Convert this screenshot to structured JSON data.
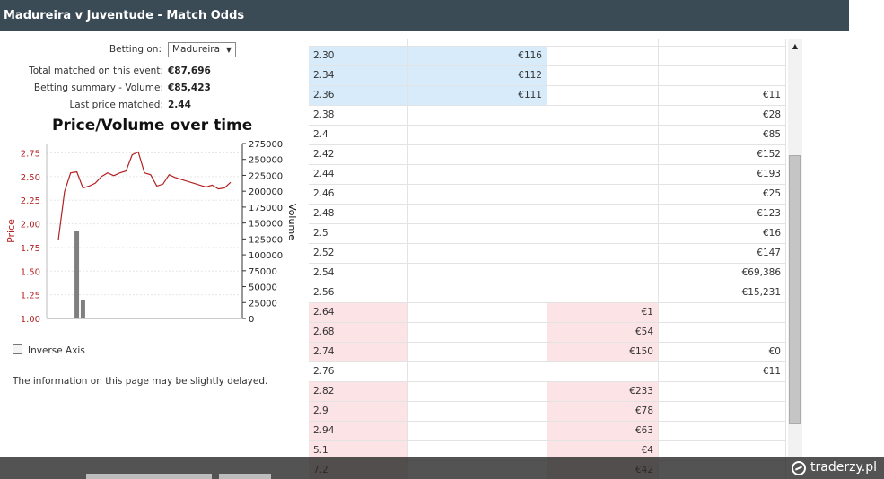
{
  "title": "Madureira v Juventude - Match Odds",
  "betting": {
    "label": "Betting on:",
    "selected": "Madureira",
    "total_label": "Total matched on this event:",
    "total_value": "€87,696",
    "summary_label": "Betting summary - Volume:",
    "summary_value": "€85,423",
    "last_label": "Last price matched:",
    "last_value": "2.44"
  },
  "chart_data": {
    "type": "line",
    "title": "Price/Volume over time",
    "ylabel": "Price",
    "y2label": "Volume",
    "ylim": [
      1.0,
      2.85
    ],
    "y_ticks": [
      "2.75",
      "2.50",
      "2.25",
      "2.00",
      "1.75",
      "1.50",
      "1.25",
      "1.00"
    ],
    "y2lim": [
      0,
      275000
    ],
    "y2_ticks": [
      "275000",
      "250000",
      "225000",
      "200000",
      "175000",
      "150000",
      "125000",
      "100000",
      "75000",
      "50000",
      "25000",
      "0"
    ],
    "series": [
      {
        "values": [
          1.83,
          2.34,
          2.54,
          2.55,
          2.38,
          2.4,
          2.43,
          2.5,
          2.54,
          2.51,
          2.54,
          2.56,
          2.73,
          2.76,
          2.54,
          2.52,
          2.4,
          2.42,
          2.52,
          2.49,
          2.47,
          2.45,
          2.43,
          2.41,
          2.39,
          2.41,
          2.37,
          2.38,
          2.44
        ]
      }
    ],
    "volume_bars": [
      {
        "index": 3,
        "value": 138000
      },
      {
        "index": 4,
        "value": 29000
      }
    ],
    "price_color": "#b22222",
    "volume_color": "#7f7f7f",
    "grid": true
  },
  "inverse_axis_label": "Inverse Axis",
  "note": "The information on this page may be slightly delayed.",
  "ladder": [
    {
      "price": "2.30",
      "a": "€116",
      "b": "",
      "c": "",
      "tone": "blue"
    },
    {
      "price": "2.34",
      "a": "€112",
      "b": "",
      "c": "",
      "tone": "blue"
    },
    {
      "price": "2.36",
      "a": "€111",
      "b": "",
      "c": "€11",
      "tone": "blue"
    },
    {
      "price": "2.38",
      "a": "",
      "b": "",
      "c": "€28",
      "tone": ""
    },
    {
      "price": "2.4",
      "a": "",
      "b": "",
      "c": "€85",
      "tone": ""
    },
    {
      "price": "2.42",
      "a": "",
      "b": "",
      "c": "€152",
      "tone": ""
    },
    {
      "price": "2.44",
      "a": "",
      "b": "",
      "c": "€193",
      "tone": ""
    },
    {
      "price": "2.46",
      "a": "",
      "b": "",
      "c": "€25",
      "tone": ""
    },
    {
      "price": "2.48",
      "a": "",
      "b": "",
      "c": "€123",
      "tone": ""
    },
    {
      "price": "2.5",
      "a": "",
      "b": "",
      "c": "€16",
      "tone": ""
    },
    {
      "price": "2.52",
      "a": "",
      "b": "",
      "c": "€147",
      "tone": ""
    },
    {
      "price": "2.54",
      "a": "",
      "b": "",
      "c": "€69,386",
      "tone": ""
    },
    {
      "price": "2.56",
      "a": "",
      "b": "",
      "c": "€15,231",
      "tone": ""
    },
    {
      "price": "2.64",
      "a": "",
      "b": "€1",
      "c": "",
      "tone": "pink"
    },
    {
      "price": "2.68",
      "a": "",
      "b": "€54",
      "c": "",
      "tone": "pink"
    },
    {
      "price": "2.74",
      "a": "",
      "b": "€150",
      "c": "€0",
      "tone": "pink"
    },
    {
      "price": "2.76",
      "a": "",
      "b": "",
      "c": "€11",
      "tone": ""
    },
    {
      "price": "2.82",
      "a": "",
      "b": "€233",
      "c": "",
      "tone": "pink"
    },
    {
      "price": "2.9",
      "a": "",
      "b": "€78",
      "c": "",
      "tone": "pink"
    },
    {
      "price": "2.94",
      "a": "",
      "b": "€63",
      "c": "",
      "tone": "pink"
    },
    {
      "price": "5.1",
      "a": "",
      "b": "€4",
      "c": "",
      "tone": "pink"
    },
    {
      "price": "7.2",
      "a": "",
      "b": "€42",
      "c": "",
      "tone": "pink"
    }
  ],
  "brand": "traderzy.pl"
}
